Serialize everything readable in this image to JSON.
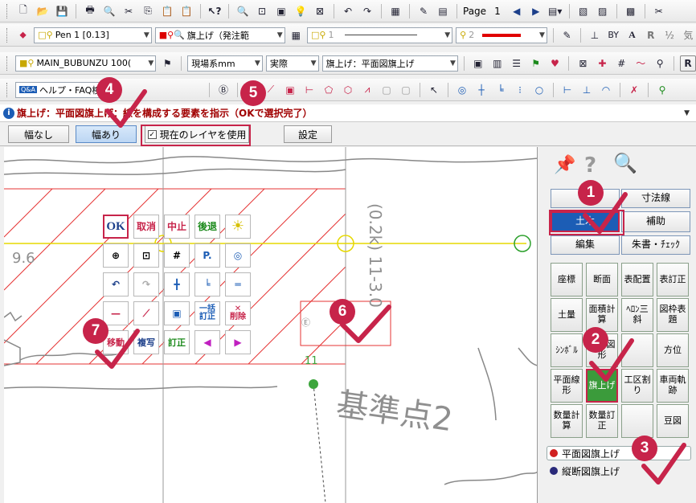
{
  "toolbar1": {
    "page_label": "Page",
    "page_number": "1"
  },
  "toolbar2": {
    "pen_select": "Pen 1 [0.13]",
    "layer_select": "旗上げ（発注範",
    "linetype_select": "1",
    "color_select": "2"
  },
  "toolbar3": {
    "drawing_select": "MAIN_BUBUNZU 100(",
    "coord_select": "現場系mm",
    "scale_select": "実際",
    "command_select": "旗上げ：平面図旗上げ"
  },
  "toolbar4": {
    "help_search": "ヘルプ・FAQ検索"
  },
  "status": {
    "message": "旗上げ：平面図旗上げ：線を構成する要素を指示（OKで選択完了）"
  },
  "options": {
    "no_width": "幅なし",
    "with_width": "幅あり",
    "use_current_layer": "現在のレイヤを使用",
    "settings": "設定"
  },
  "canvas": {
    "label_base_point": "基準点2",
    "label_11": "11",
    "label_96": "9.6",
    "label_vertical": "(0.2k) 11-3.0"
  },
  "palette": {
    "ok": "OK",
    "cancel": "取消",
    "stop": "中止",
    "back": "後退",
    "correct": "訂正",
    "bulk": "一括",
    "delete": "削除",
    "move": "移動",
    "copy": "複写",
    "edit": "訂正"
  },
  "right_panel": {
    "tabs": [
      "寸法線",
      "土木",
      "補助",
      "編集",
      "朱書・ﾁｪｯｸ"
    ],
    "grid": [
      [
        "座標",
        "断面",
        "表配置",
        "表訂正"
      ],
      [
        "土量",
        "面積計算",
        "ﾍﾛﾝ三斜",
        "図枠表題"
      ],
      [
        "ｼﾝﾎﾞﾙ",
        "特殊図形",
        "",
        "方位"
      ],
      [
        "平面線形",
        "旗上げ",
        "工区割り",
        "車両軌跡"
      ],
      [
        "数量計算",
        "数量訂正",
        "",
        "豆図"
      ]
    ],
    "radio_plan": "平面図旗上げ",
    "radio_profile": "縦断図旗上げ"
  },
  "badges": [
    "1",
    "2",
    "3",
    "4",
    "5",
    "6",
    "7"
  ],
  "colors": {
    "accent": "#c7244a",
    "select_blue": "#1c5db5",
    "select_green": "#3b9b3b",
    "status_text": "#a00000"
  }
}
